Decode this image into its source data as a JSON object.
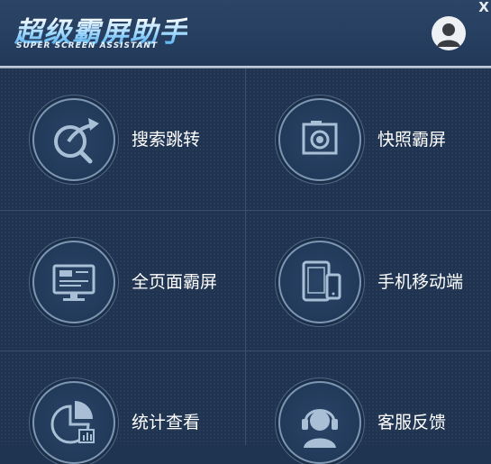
{
  "app": {
    "title": "超级霸屏助手",
    "subtitle": "SUPER SCREEN ASSISTANT",
    "close_label": "X",
    "avatar_icon": "user-avatar-icon"
  },
  "tiles": [
    {
      "label": "搜索跳转",
      "icon": "search-redirect-icon"
    },
    {
      "label": "快照霸屏",
      "icon": "camera-icon"
    },
    {
      "label": "全页面霸屏",
      "icon": "monitor-icon"
    },
    {
      "label": "手机移动端",
      "icon": "tablet-phone-icon"
    },
    {
      "label": "统计查看",
      "icon": "pie-chart-icon"
    },
    {
      "label": "客服反馈",
      "icon": "headset-icon"
    }
  ],
  "colors": {
    "background": "#1f3450",
    "icon_stroke": "#a9bfd6",
    "text": "#ffffff"
  }
}
